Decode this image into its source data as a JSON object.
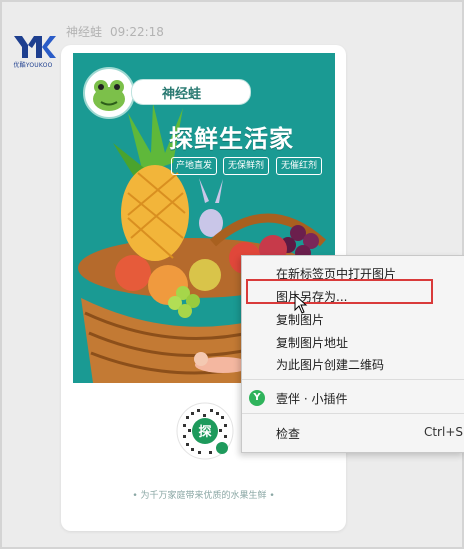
{
  "sender": {
    "logo_text": "YK",
    "logo_caption": "优酷YOUKOO",
    "name": "神经蛙",
    "time": "09:22:18",
    "brand_color": "#1e3f8f"
  },
  "poster": {
    "profile_name": "神经蛙",
    "headline": "探鲜生活家",
    "tags": [
      "产地直发",
      "无保鲜剂",
      "无催红剂"
    ],
    "background_color": "#1a9a93",
    "qr_center_char": "探",
    "slogan": "• 为千万家庭带来优质的水果生鲜 •"
  },
  "context_menu": {
    "items": [
      {
        "label": "在新标签页中打开图片"
      },
      {
        "label": "图片另存为..."
      },
      {
        "label": "复制图片"
      },
      {
        "label": "复制图片地址"
      },
      {
        "label": "为此图片创建二维码"
      },
      {
        "label": "壹伴 · 小插件",
        "icon": "yiban-extension-icon"
      },
      {
        "label": "检查",
        "shortcut": "Ctrl+S"
      }
    ],
    "highlighted_index": 1,
    "highlight_color": "#d93a3a"
  }
}
